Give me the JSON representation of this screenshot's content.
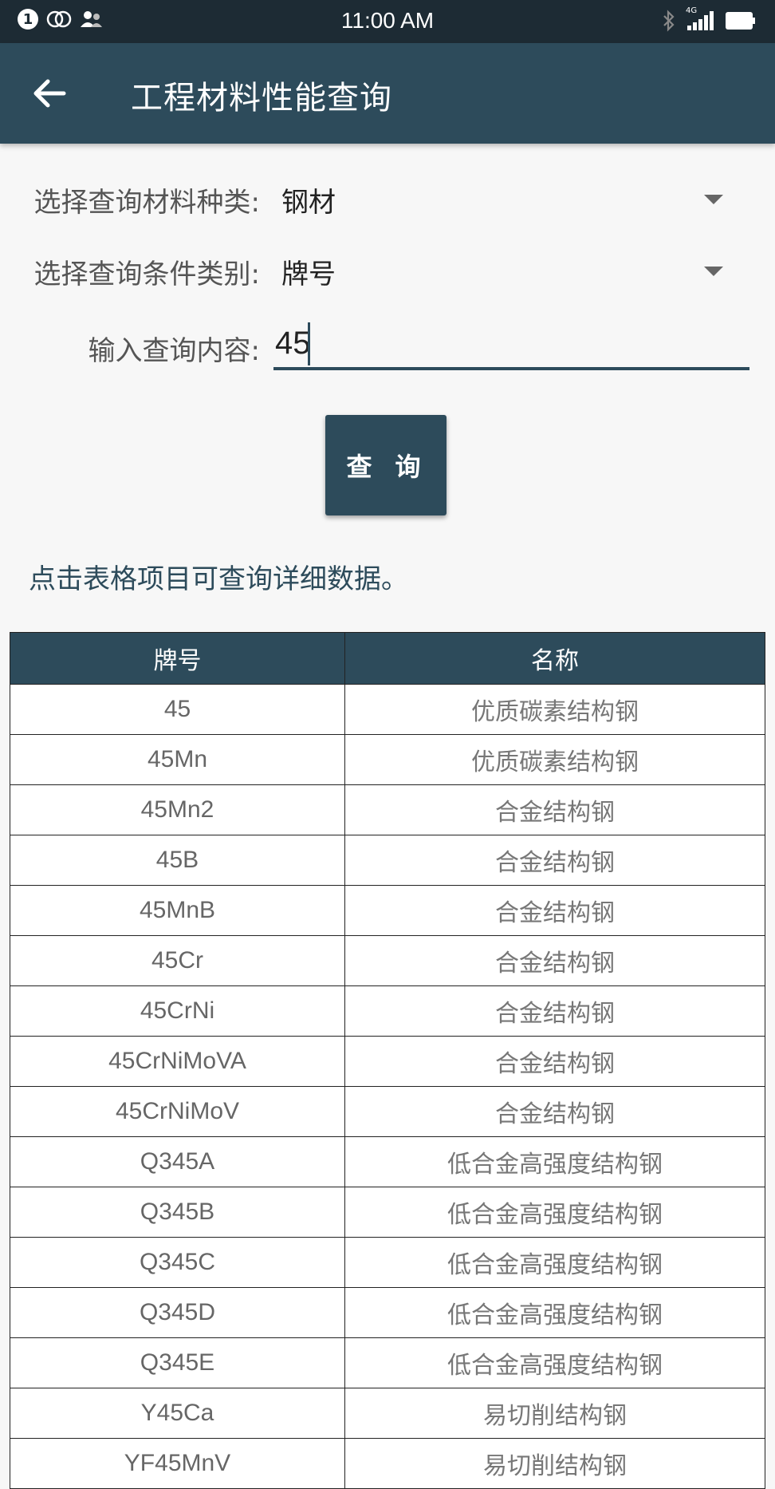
{
  "status_bar": {
    "time": "11:00 AM",
    "notification_count": "1",
    "network": "4G"
  },
  "app_bar": {
    "title": "工程材料性能查询"
  },
  "form": {
    "material_type_label": "选择查询材料种类:",
    "material_type_value": "钢材",
    "condition_label": "选择查询条件类别:",
    "condition_value": "牌号",
    "input_label": "输入查询内容:",
    "input_value": "45",
    "query_button": "查 询"
  },
  "hint_text": "点击表格项目可查询详细数据。",
  "table": {
    "headers": [
      "牌号",
      "名称"
    ],
    "rows": [
      [
        "45",
        "优质碳素结构钢"
      ],
      [
        "45Mn",
        "优质碳素结构钢"
      ],
      [
        "45Mn2",
        "合金结构钢"
      ],
      [
        "45B",
        "合金结构钢"
      ],
      [
        "45MnB",
        "合金结构钢"
      ],
      [
        "45Cr",
        "合金结构钢"
      ],
      [
        "45CrNi",
        "合金结构钢"
      ],
      [
        "45CrNiMoVA",
        "合金结构钢"
      ],
      [
        "45CrNiMoV",
        "合金结构钢"
      ],
      [
        "Q345A",
        "低合金高强度结构钢"
      ],
      [
        "Q345B",
        "低合金高强度结构钢"
      ],
      [
        "Q345C",
        "低合金高强度结构钢"
      ],
      [
        "Q345D",
        "低合金高强度结构钢"
      ],
      [
        "Q345E",
        "低合金高强度结构钢"
      ],
      [
        "Y45Ca",
        "易切削结构钢"
      ],
      [
        "YF45MnV",
        "易切削结构钢"
      ]
    ]
  },
  "colors": {
    "primary": "#2d4b5b",
    "status_bar": "#1d2b34",
    "background": "#f7f7f7"
  }
}
